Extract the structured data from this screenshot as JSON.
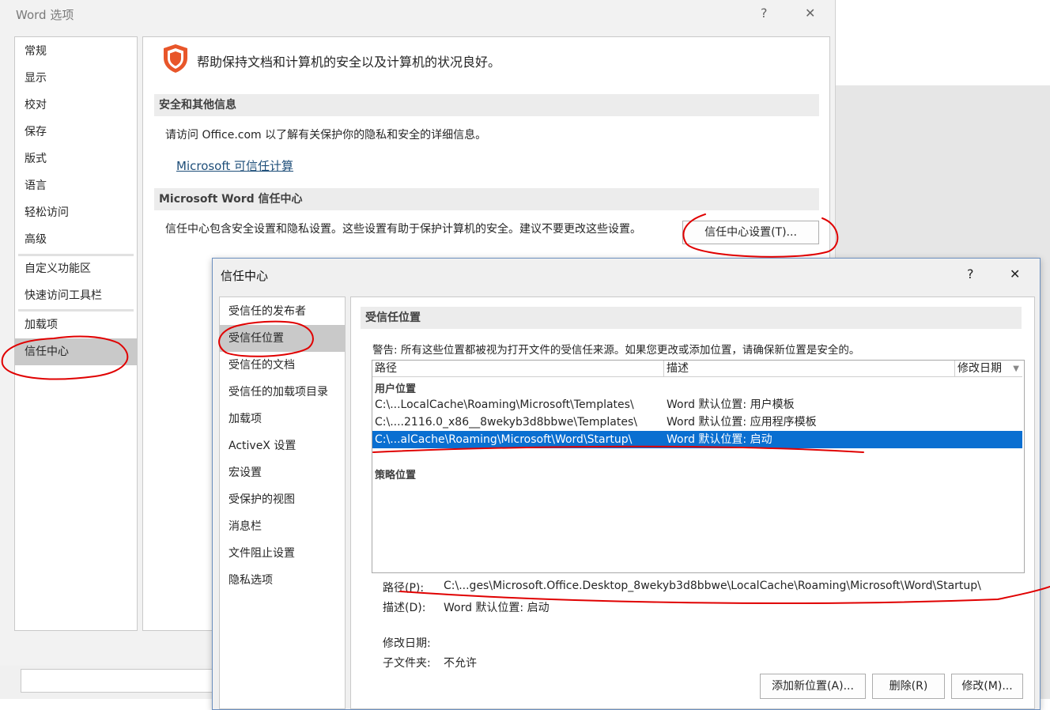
{
  "word_options": {
    "title": "Word 选项",
    "help": "?",
    "close": "✕",
    "nav": [
      {
        "label": "常规"
      },
      {
        "label": "显示"
      },
      {
        "label": "校对"
      },
      {
        "label": "保存"
      },
      {
        "label": "版式"
      },
      {
        "label": "语言"
      },
      {
        "label": "轻松访问"
      },
      {
        "label": "高级"
      },
      {
        "label": "自定义功能区"
      },
      {
        "label": "快速访问工具栏"
      },
      {
        "label": "加载项"
      },
      {
        "label": "信任中心"
      }
    ],
    "selected_nav": "信任中心",
    "intro": "帮助保持文档和计算机的安全以及计算机的状况良好。",
    "section1": {
      "title": "安全和其他信息",
      "text": "请访问 Office.com 以了解有关保护你的隐私和安全的详细信息。",
      "link": "Microsoft 可信任计算"
    },
    "section2": {
      "title": "Microsoft Word 信任中心",
      "text": "信任中心包含安全设置和隐私设置。这些设置有助于保护计算机的安全。建议不要更改这些设置。",
      "button": "信任中心设置(T)..."
    }
  },
  "trust_center": {
    "title": "信任中心",
    "help": "?",
    "close": "✕",
    "nav": [
      {
        "label": "受信任的发布者"
      },
      {
        "label": "受信任位置"
      },
      {
        "label": "受信任的文档"
      },
      {
        "label": "受信任的加载项目录"
      },
      {
        "label": "加载项"
      },
      {
        "label": "ActiveX 设置"
      },
      {
        "label": "宏设置"
      },
      {
        "label": "受保护的视图"
      },
      {
        "label": "消息栏"
      },
      {
        "label": "文件阻止设置"
      },
      {
        "label": "隐私选项"
      }
    ],
    "selected_nav": "受信任位置",
    "section_title": "受信任位置",
    "warning": "警告: 所有这些位置都被视为打开文件的受信任来源。如果您更改或添加位置，请确保新位置是安全的。",
    "table": {
      "columns": [
        "路径",
        "描述",
        "修改日期"
      ],
      "user_group": "用户位置",
      "rows": [
        {
          "path": "C:\\...LocalCache\\Roaming\\Microsoft\\Templates\\",
          "desc": "Word 默认位置: 用户模板",
          "selected": false
        },
        {
          "path": "C:\\....2116.0_x86__8wekyb3d8bbwe\\Templates\\",
          "desc": "Word 默认位置: 应用程序模板",
          "selected": false
        },
        {
          "path": "C:\\...alCache\\Roaming\\Microsoft\\Word\\Startup\\",
          "desc": "Word 默认位置: 启动",
          "selected": true
        }
      ],
      "policy_group": "策略位置"
    },
    "details": {
      "path_label": "路径(P):",
      "path_value": "C:\\...ges\\Microsoft.Office.Desktop_8wekyb3d8bbwe\\LocalCache\\Roaming\\Microsoft\\Word\\Startup\\",
      "desc_label": "描述(D):",
      "desc_value": "Word 默认位置: 启动",
      "date_label": "修改日期:",
      "date_value": "",
      "subfolder_label": "子文件夹:",
      "subfolder_value": "不允许"
    },
    "buttons": {
      "add": "添加新位置(A)...",
      "remove": "删除(R)",
      "modify": "修改(M)..."
    }
  },
  "colors": {
    "selection": "#0a6fd1",
    "annotation": "#e00000",
    "shield": "#e8562a"
  }
}
